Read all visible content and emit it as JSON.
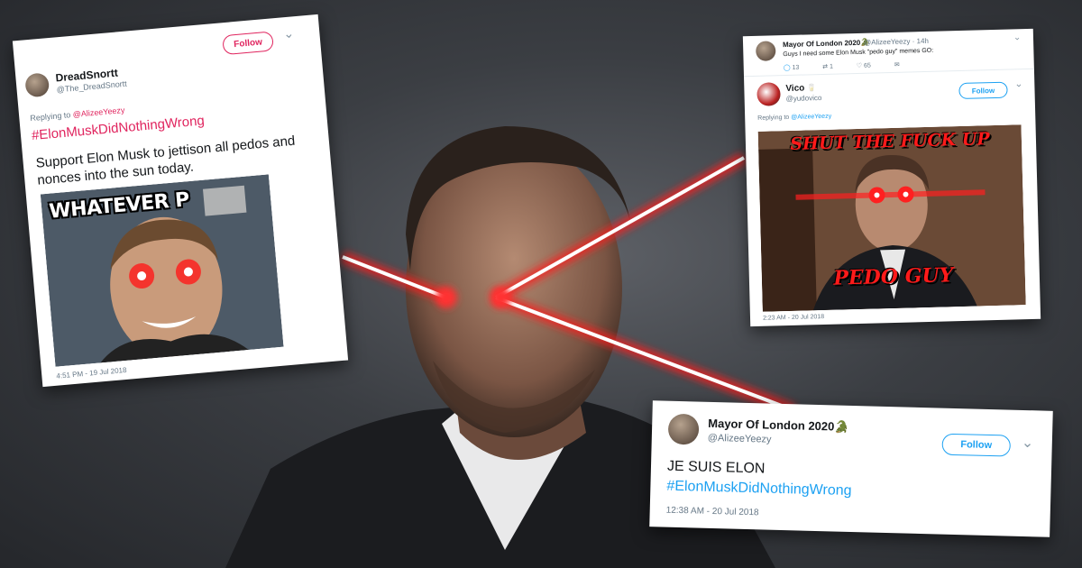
{
  "tweet_left": {
    "name": "DreadSnortt",
    "handle": "@The_DreadSnortt",
    "follow": "Follow",
    "chevron": "⌄",
    "replying_prefix": "Replying to ",
    "replying_to": "@AlizeeYeezy",
    "hashtag": "#ElonMuskDidNothingWrong",
    "text": "Support Elon Musk to jettison all pedos and nonces into the sun today.",
    "meme_caption": "WHATEVER P",
    "timestamp": "4:51 PM - 19 Jul 2018",
    "accent": "#e0245e"
  },
  "tweet_top_right": {
    "parent": {
      "name": "Mayor Of London 2020",
      "emoji": "🐊",
      "handle": "@AlizeeYeezy · 14h",
      "text": "Guys I need some Elon Musk \"pedo guy\" memes GO:",
      "replies": "13",
      "retweets": "1",
      "likes": "65"
    },
    "reply": {
      "name": "Vico",
      "emoji": "🥛",
      "handle": "@yudovico",
      "follow": "Follow",
      "chevron": "⌄",
      "replying_prefix": "Replying to ",
      "replying_to": "@AlizeeYeezy",
      "meme_top": "SHUT THE FUCK UP",
      "meme_bottom": "PEDO GUY",
      "timestamp": "2:23 AM - 20 Jul 2018"
    },
    "accent": "#1da1f2"
  },
  "tweet_bottom_right": {
    "name": "Mayor Of London 2020",
    "emoji": "🐊",
    "handle": "@AlizeeYeezy",
    "follow": "Follow",
    "chevron": "⌄",
    "text": "JE SUIS ELON",
    "hashtag": "#ElonMuskDidNothingWrong",
    "timestamp": "12:38 AM - 20 Jul 2018",
    "accent": "#1da1f2"
  },
  "laser_color": "#ff1a1a"
}
